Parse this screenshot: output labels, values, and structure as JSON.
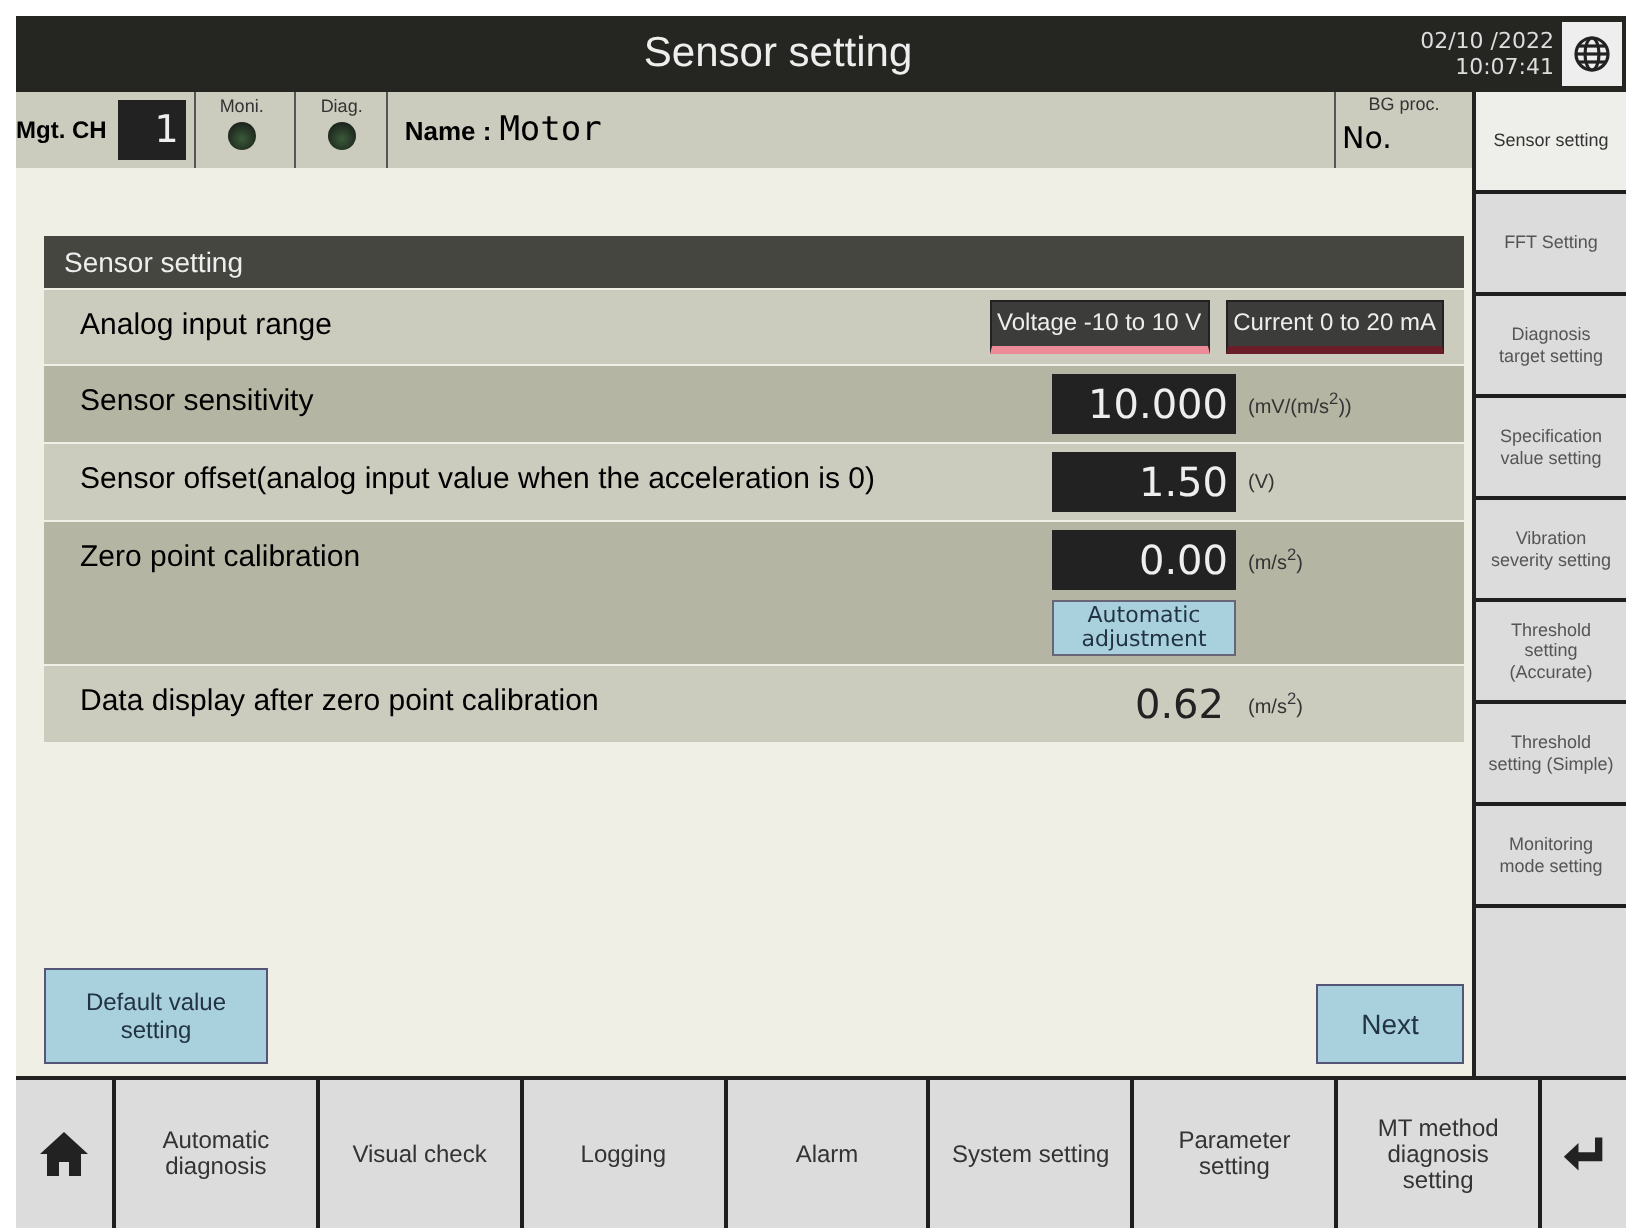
{
  "window": {
    "title": "Sensor setting",
    "date": "02/10 /2022",
    "time": "10:07:41"
  },
  "info_bar": {
    "channel_label": "Mgt. CH",
    "channel": "1",
    "monitor_label": "Moni.",
    "monitor_on": false,
    "diagnosis_label": "Diag.",
    "diagnosis_on": false,
    "name_label": "Name :",
    "name": "Motor",
    "bg_label": "BG proc.",
    "bg_value": "No."
  },
  "panel": {
    "title": "Sensor setting",
    "rows": [
      {
        "kind": "choice",
        "label": "Analog input range",
        "options": [
          {
            "label": "Voltage -10 to 10 V",
            "selected": true
          },
          {
            "label": "Current 0 to 20 mA",
            "selected": false
          }
        ]
      },
      {
        "kind": "field",
        "label": "Sensor sensitivity",
        "value": "10.000",
        "unit": "(mV/(m/s$^{2}$))"
      },
      {
        "kind": "field",
        "label": "Sensor offset(analog input value when the acceleration is 0)",
        "value": "1.50",
        "unit": "(V)"
      },
      {
        "kind": "field",
        "label": "Zero point calibration",
        "value": "0.00",
        "unit": "(m/s$^{2}$)",
        "button": "Automatic adjustment"
      },
      {
        "kind": "display",
        "label": "Data display after zero point calibration",
        "value": "0.62",
        "unit": "(m/s$^{2}$)"
      }
    ]
  },
  "buttons": {
    "left": "Default value setting",
    "right": "Next"
  },
  "sidebar": {
    "items": [
      {
        "label": "Sensor setting",
        "selected": true
      },
      {
        "label": "FFT Setting",
        "selected": false
      },
      {
        "label": "Diagnosis target setting",
        "selected": false
      },
      {
        "label": "Specification value setting",
        "selected": false
      },
      {
        "label": "Vibration severity setting",
        "selected": false
      },
      {
        "label": "Threshold setting (Accurate)",
        "selected": false
      },
      {
        "label": "Threshold setting (Simple)",
        "selected": false
      },
      {
        "label": "Monitoring mode setting",
        "selected": false
      }
    ]
  },
  "bottom_nav": {
    "items": [
      "Automatic diagnosis",
      "Visual check",
      "Logging",
      "Alarm",
      "System setting",
      "Parameter setting",
      "MT method diagnosis setting"
    ]
  }
}
